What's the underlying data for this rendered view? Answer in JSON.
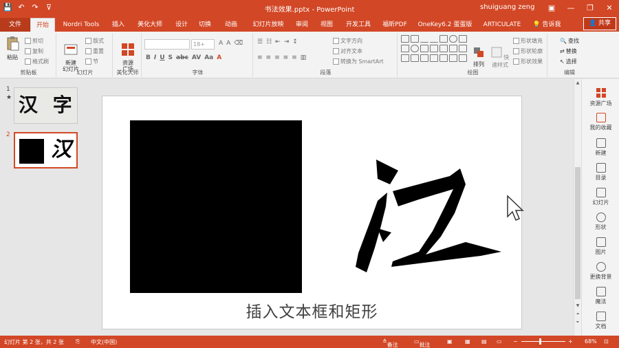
{
  "window": {
    "title": "书法效果.pptx - PowerPoint",
    "user": "shuiguang zeng",
    "minimize": "—",
    "restore": "❐",
    "close": "✕"
  },
  "qat": {
    "save": "💾",
    "undo": "↶",
    "redo": "↷",
    "customize": "⊽"
  },
  "tabs": [
    "文件",
    "开始",
    "Nordri Tools",
    "插入",
    "美化大师",
    "设计",
    "切换",
    "动画",
    "幻灯片放映",
    "审阅",
    "视图",
    "开发工具",
    "福昕PDF",
    "OneKey6.2 蛋蛋版",
    "ARTICULATE"
  ],
  "tell_me": "告诉我",
  "share": "共享",
  "ribbon": {
    "clipboard": {
      "paste": "粘贴",
      "cut": "剪切",
      "copy": "复制",
      "format_painter": "格式刷",
      "label": "剪贴板"
    },
    "slides": {
      "new_slide": "新建\n幻灯片",
      "layout": "版式",
      "reset": "重置",
      "section": "节",
      "label": "幻灯片"
    },
    "meihua": {
      "resource": "资源\n广场",
      "label": "美化大师"
    },
    "font": {
      "size": "18+",
      "label": "字体"
    },
    "paragraph": {
      "text_direction": "文字方向",
      "align_text": "对齐文本",
      "smartart": "转换为 SmartArt",
      "label": "段落"
    },
    "drawing": {
      "arrange": "排列",
      "quick_styles": "快速样式",
      "shape_fill": "形状填充",
      "shape_outline": "形状轮廓",
      "shape_effects": "形状效果",
      "label": "绘图"
    },
    "editing": {
      "find": "查找",
      "replace": "替换",
      "select": "选择",
      "label": "编辑"
    }
  },
  "thumbnails": [
    {
      "number": "1",
      "star": "★",
      "text": "汉 字"
    },
    {
      "number": "2",
      "text": "汉"
    }
  ],
  "slide": {
    "glyph": "汉",
    "caption": "插入文本框和矩形"
  },
  "right_pane": [
    "资源广场",
    "我的收藏",
    "新建",
    "目录",
    "幻灯片",
    "形状",
    "图片",
    "更换背景",
    "魔法",
    "文档"
  ],
  "status": {
    "slide_info": "幻灯片 第 2 张，共 2 张",
    "language": "中文(中国)",
    "notes": "备注",
    "comments": "批注",
    "zoom": "68%"
  },
  "colors": {
    "accent": "#d24726"
  }
}
